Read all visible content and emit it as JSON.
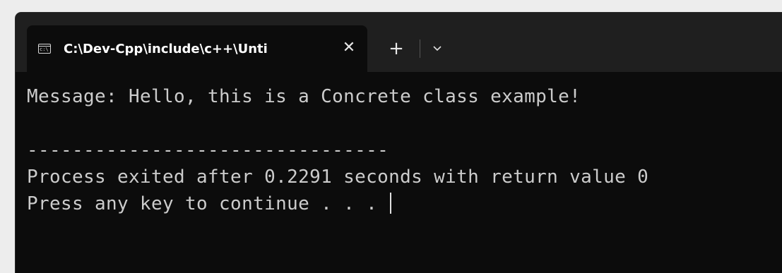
{
  "tab": {
    "icon": "console-icon",
    "icon_glyph": "c:\\",
    "title": "C:\\Dev-Cpp\\include\\c++\\Unti",
    "close_glyph": "✕"
  },
  "toolbar": {
    "new_tab_glyph": "+",
    "dropdown_icon": "chevron-down-icon"
  },
  "terminal": {
    "lines": [
      "Message: Hello, this is a Concrete class example!",
      "",
      "--------------------------------",
      "Process exited after 0.2291 seconds with return value 0",
      "Press any key to continue . . . "
    ]
  },
  "colors": {
    "titlebar": "#1f1f1f",
    "terminal_bg": "#0c0c0c",
    "terminal_text": "#cccccc"
  }
}
